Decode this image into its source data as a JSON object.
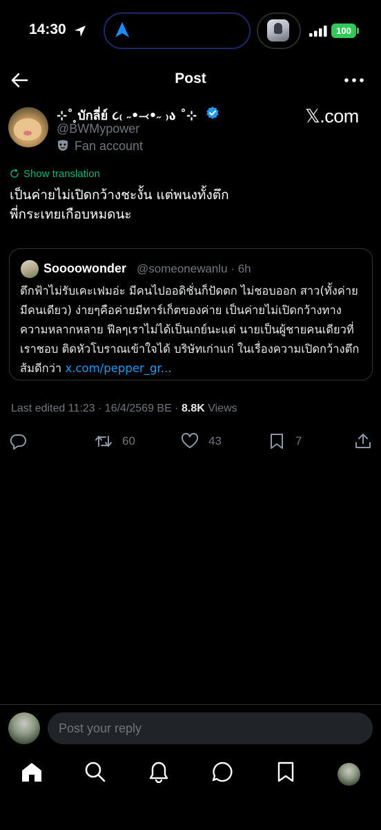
{
  "status_bar": {
    "time": "14:30",
    "battery": "100"
  },
  "header": {
    "title": "Post"
  },
  "post": {
    "author_name": "⊹˚ ̥บักลี่ย์ ૮₍ ˶•⤙•˶ ₎ა ˚⊹",
    "author_handle": "@BWMypower",
    "affiliation": "Fan account",
    "badge_text": "𝕏.com",
    "show_translation": "Show translation",
    "body_line1": "เป็นค่ายไม่เปิดกว้างชะงั้น แต่พนงทั้งตึก",
    "body_line2": "พี่กระเทยเกือบหมดนะ"
  },
  "quote": {
    "name": "Soooowonder",
    "handle_time": "@someonewanlu · 6h",
    "body": "ตึกฟ้าไม่รับเคะเฟมอ่ะ มีคนไปออดิชั่นก็ปัดตก ไม่ชอบออก สาว(ทั้งค่ายมีคนเดียว) ง่ายๆคือค่ายมีทาร์เก็ตของค่าย เป็นค่ายไม่เปิดกว้างทางความหลากหลาย  ฟีลๆเราไม่ได้เป็นเกย์นะแต่ นายเป็นผู้ชายคนเดียวที่เราชอบ ติดหัวโบราณเข้าใจได้ บริษัทเก่าแก่  ในเรื่องความเปิดกว้างตึกส้มดีกว่า ",
    "link": "x.com/pepper_gr..."
  },
  "meta": {
    "edited": "Last edited 11:23 · 16/4/2569 BE · ",
    "views_count": "8.8K",
    "views_label": " Views"
  },
  "actions": {
    "reposts": "60",
    "likes": "43",
    "bookmarks": "7"
  },
  "reply": {
    "placeholder": "Post your reply"
  },
  "colors": {
    "accent": "#1d9bf0",
    "translation": "#00ba7c",
    "muted": "#71767b",
    "battery": "#34c759"
  }
}
